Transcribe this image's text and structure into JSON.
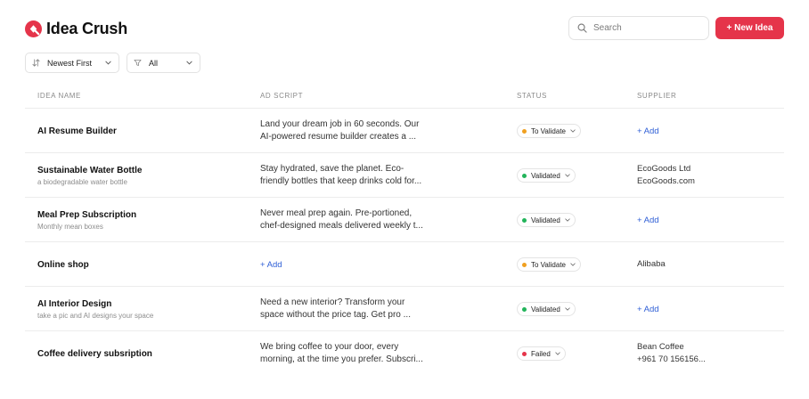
{
  "app": {
    "title": "Idea Crush",
    "brand_color": "#e5344a"
  },
  "header": {
    "search_placeholder": "Search",
    "new_button_label": "+ New Idea"
  },
  "filters": {
    "sort": {
      "label": "Newest First",
      "icon": "sort-icon"
    },
    "category": {
      "label": "All",
      "icon": "filter-icon"
    }
  },
  "table": {
    "columns": [
      "IDEA NAME",
      "AD SCRIPT",
      "STATUS",
      "SUPPLIER"
    ],
    "add_label": "+ Add",
    "rows": [
      {
        "name": "AI Resume Builder",
        "subtitle": "",
        "script": "Land your dream job in 60 seconds. Our AI-powered resume builder creates a ...",
        "status": "To Validate",
        "status_color": "#f0a020",
        "supplier": []
      },
      {
        "name": "Sustainable Water Bottle",
        "subtitle": "a biodegradable water bottle",
        "script": "Stay hydrated, save the planet. Eco-friendly bottles that keep drinks cold for...",
        "status": "Validated",
        "status_color": "#22b45a",
        "supplier": [
          "EcoGoods Ltd",
          "EcoGoods.com"
        ]
      },
      {
        "name": "Meal Prep Subscription",
        "subtitle": "Monthly mean boxes",
        "script": "Never meal prep again. Pre-portioned, chef-designed meals delivered weekly t...",
        "status": "Validated",
        "status_color": "#22b45a",
        "supplier": []
      },
      {
        "name": "Online shop",
        "subtitle": "",
        "script": "",
        "status": "To Validate",
        "status_color": "#f0a020",
        "supplier": [
          "Alibaba"
        ]
      },
      {
        "name": "AI Interior Design",
        "subtitle": "take a pic and AI designs your space",
        "script": "Need a new interior? Transform your space without the price tag. Get pro ...",
        "status": "Validated",
        "status_color": "#22b45a",
        "supplier": []
      },
      {
        "name": "Coffee delivery subsription",
        "subtitle": "",
        "script": "We bring coffee to your door, every morning, at the time you prefer. Subscri...",
        "status": "Failed",
        "status_color": "#e5344a",
        "supplier": [
          "Bean Coffee",
          "+961 70 156156..."
        ]
      }
    ]
  }
}
